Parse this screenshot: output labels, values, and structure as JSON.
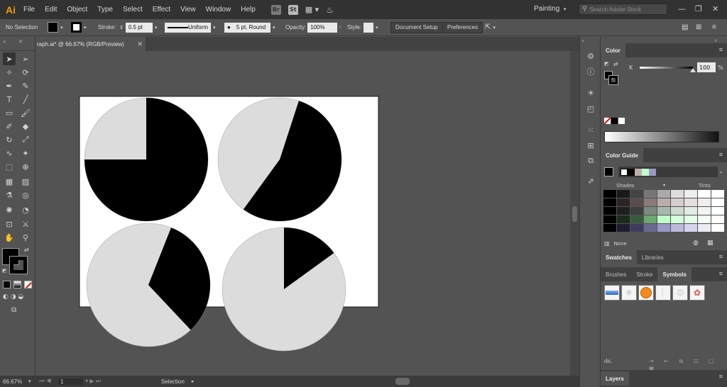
{
  "app": {
    "logo": "Ai",
    "menu": [
      "File",
      "Edit",
      "Object",
      "Type",
      "Select",
      "Effect",
      "View",
      "Window",
      "Help"
    ],
    "bridge_icon": "Br",
    "stock_icon": "St",
    "workspace": "Painting",
    "search_placeholder": "Search Adobe Stock"
  },
  "control_bar": {
    "selection_status": "No Selection",
    "stroke_label": "Stroke:",
    "stroke_weight": "0.5 pt",
    "profile": "Uniform",
    "brush": "5 pt. Round",
    "opacity_label": "Opacity:",
    "opacity_value": "100%",
    "style_label": "Style:",
    "document_setup": "Document Setup",
    "preferences": "Preferences"
  },
  "document": {
    "tab_title": "raph.ai* @ 66.67% (RGB/Preview)",
    "close_glyph": "✕"
  },
  "status_bar": {
    "zoom": "66.67%",
    "artboard_number": "1",
    "tool_name": "Selection"
  },
  "color_panel": {
    "tab": "Color",
    "channel": "K",
    "value": "100",
    "unit": "%"
  },
  "color_guide_panel": {
    "tab": "Color Guide",
    "shades_label": "Shades",
    "tints_label": "Tints",
    "mode": "None"
  },
  "swatches_tabs": [
    "Swatches",
    "Libraries"
  ],
  "symbols_tabs": [
    "Brushes",
    "Stroke",
    "Symbols"
  ],
  "layers_tab": "Layers",
  "colors": {
    "pie_fill": "#000000",
    "pie_background": "#dcdcdc",
    "artboard": "#ffffff",
    "guide_green": "#bfffc9",
    "guide_purple": "#9a97c6",
    "guide_rose": "#bcadad"
  },
  "pies": [
    {
      "name": "pie-1",
      "black_fraction": 0.75
    },
    {
      "name": "pie-2",
      "black_fraction": 0.55
    },
    {
      "name": "pie-3",
      "black_fraction": 0.32
    },
    {
      "name": "pie-4",
      "black_fraction": 0.15
    }
  ]
}
